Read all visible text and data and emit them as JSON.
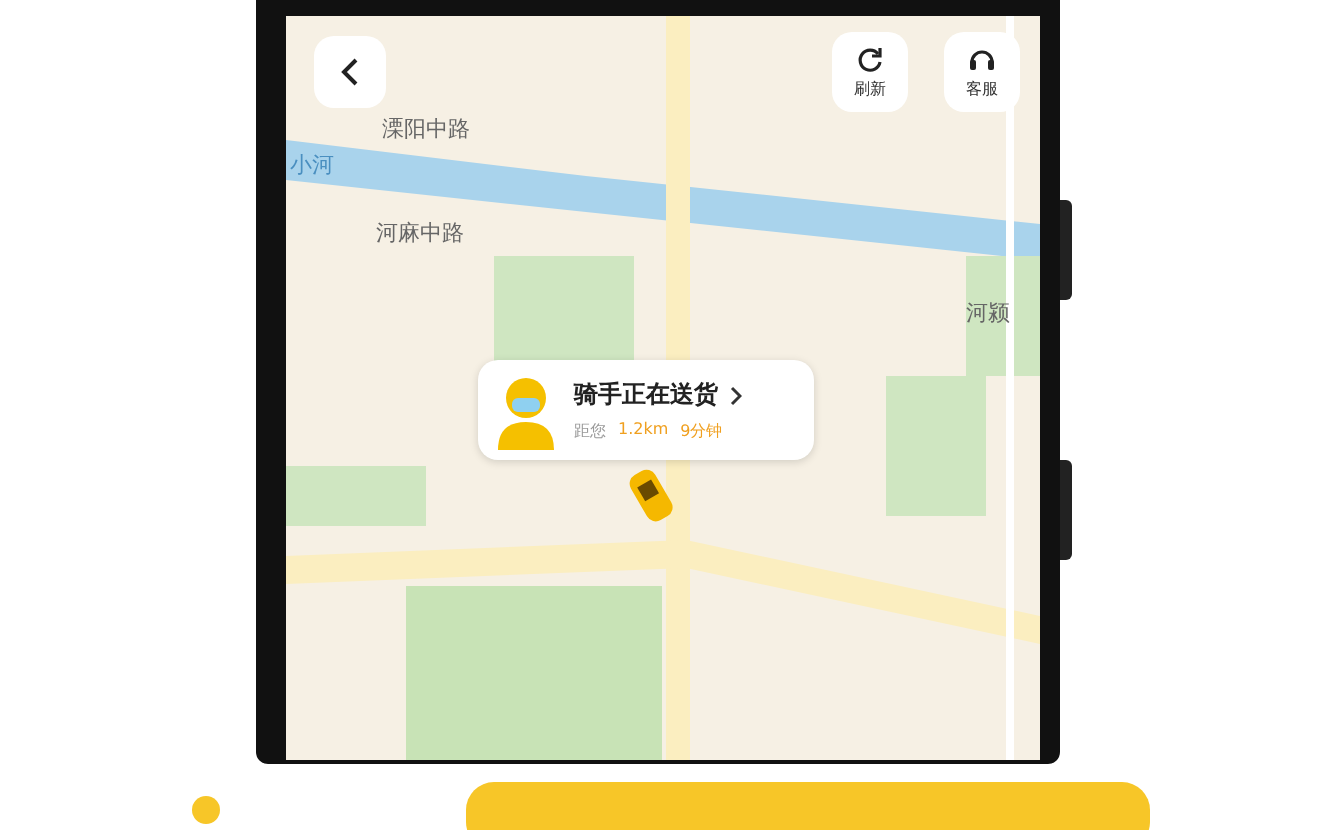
{
  "map": {
    "labels": [
      {
        "text": "溧阳中路",
        "kind": "road"
      },
      {
        "text": "小河",
        "kind": "water"
      },
      {
        "text": "河麻中路",
        "kind": "road"
      },
      {
        "text": "河颍",
        "kind": "road"
      }
    ]
  },
  "toolbar": {
    "buttons": [
      {
        "label": "刷新",
        "kind": "refresh"
      },
      {
        "label": "客服",
        "kind": "support"
      }
    ]
  },
  "rider_card": {
    "title": "骑手正在送货",
    "distance_label": "距您",
    "distance": "1.2km",
    "eta": "9分钟"
  }
}
